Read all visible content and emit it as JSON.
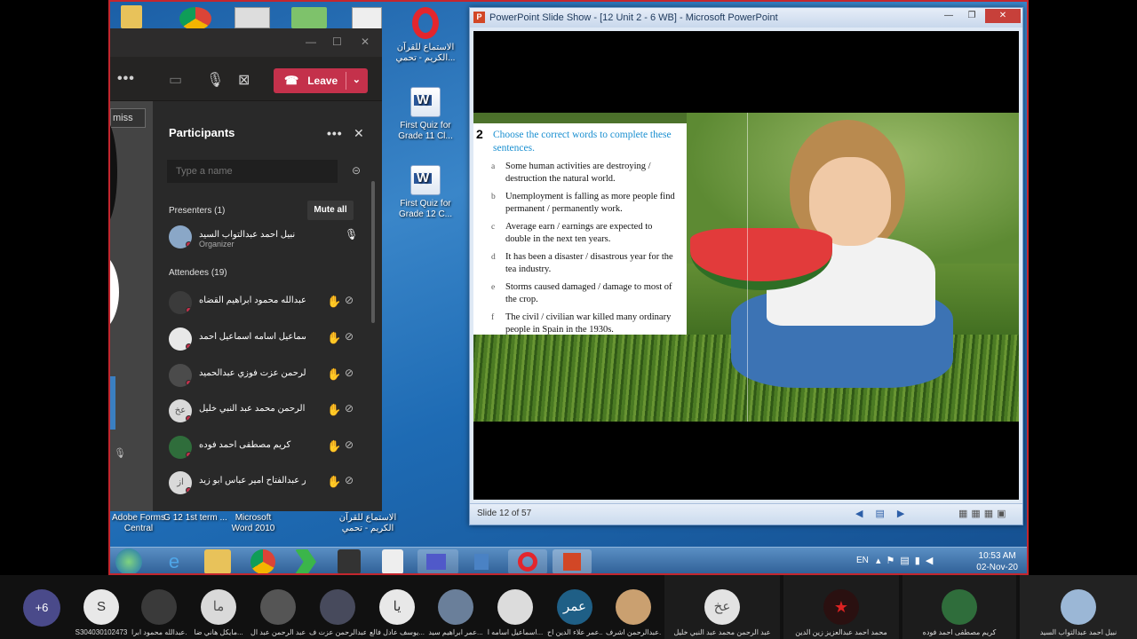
{
  "desktop_icons": [
    {
      "label": "الاستماع للقرآن الكريم - تحمي...",
      "name": "quran-shortcut"
    },
    {
      "label": "First Quiz for Grade 11 Cl...",
      "name": "word-doc-grade11"
    },
    {
      "label": "First Quiz for Grade 12 C...",
      "name": "word-doc-grade12"
    },
    {
      "label": "Adobe Forms Central",
      "name": "adobe-forms"
    },
    {
      "label": "G 12 1st term ...",
      "name": "g12-folder"
    },
    {
      "label": "Microsoft Word 2010",
      "name": "word-2010"
    },
    {
      "label": "الاستماع للقرآن الكريم - تحمي",
      "name": "quran-shortcut-2"
    }
  ],
  "teams": {
    "leave_label": "Leave",
    "dismiss_label": "miss",
    "participants_title": "Participants",
    "search_placeholder": "Type a name",
    "presenters_header": "Presenters (1)",
    "mute_all_label": "Mute all",
    "attendees_header": "Attendees (19)",
    "presenter": {
      "name": "نبيل احمد عبدالتواب السيد",
      "role": "Organizer",
      "initials": ""
    },
    "attendees": [
      {
        "name": "عبدالله محمود ابراهيم القضاه",
        "initials": "",
        "color": "#3b3b3b"
      },
      {
        "name": "اسماعيل اسامه اسماعيل احمد",
        "initials": "",
        "color": "#e8e8e8"
      },
      {
        "name": "عبدالرحمن عزت فوزي عبدالحميد",
        "initials": "",
        "color": "#4b4b4b"
      },
      {
        "name": "عبد الرحمن محمد عبد النبي خليل",
        "initials": "عخ",
        "color": "#d9d9d9"
      },
      {
        "name": "كريم مصطفى احمد فوده",
        "initials": "",
        "color": "#2f6d3b"
      },
      {
        "name": "امير عبدالفتاح امير عباس ابو زيد",
        "initials": "از",
        "color": "#d9d9d9"
      }
    ]
  },
  "ppt": {
    "window_title": "PowerPoint Slide Show - [12 Unit 2 - 6 WB] - Microsoft PowerPoint",
    "slide_status": "Slide 12 of 57",
    "exercise_number": "2",
    "exercise_heading": "Choose the correct words to complete these sentences.",
    "questions": [
      {
        "letter": "a",
        "text": "Some human activities are destroying / destruction the natural world."
      },
      {
        "letter": "b",
        "text": "Unemployment is falling as more people find permanent / permanently work."
      },
      {
        "letter": "c",
        "text": "Average earn / earnings are expected to double in the next ten years."
      },
      {
        "letter": "d",
        "text": "It has been a disaster / disastrous year for the tea industry."
      },
      {
        "letter": "e",
        "text": "Storms caused damaged / damage to most of the crop."
      },
      {
        "letter": "f",
        "text": "The civil / civilian war killed many ordinary people in Spain in the 1930s."
      }
    ]
  },
  "taskbar": {
    "lang": "EN",
    "time": "10:53 AM",
    "date": "02-Nov-20"
  },
  "strip": {
    "more_count": "+6",
    "tiles": [
      {
        "initials": "S",
        "name": "S304030102473",
        "color": "#e8e8e8",
        "text_color": "#333"
      },
      {
        "initials": "",
        "name": "عبدالله محمود ابرا...",
        "color": "#3a3a3a",
        "text_color": "#fff"
      },
      {
        "initials": "ما",
        "name": "مايكل هاني ضا...",
        "color": "#d9d9d9",
        "text_color": "#333"
      },
      {
        "initials": "",
        "name": "عبد الرحمن عبد ال...",
        "color": "#555555",
        "text_color": "#fff"
      },
      {
        "initials": "",
        "name": "عبدالرحمن عزت ف...",
        "color": "#474a5c",
        "text_color": "#fff"
      },
      {
        "initials": "يا",
        "name": "يوسف عادل فالع...",
        "color": "#e8e8e8",
        "text_color": "#333"
      },
      {
        "initials": "",
        "name": "عمر ابراهيم سيد...",
        "color": "#6a7f9a",
        "text_color": "#fff"
      },
      {
        "initials": "",
        "name": "اسماعيل اسامه ا...",
        "color": "#dcdcdc",
        "text_color": "#fff"
      },
      {
        "initials": "عمر",
        "name": "عمر علاء الدين اح...",
        "color": "#1f5f86",
        "text_color": "#fff"
      },
      {
        "initials": "",
        "name": "عبدالرحمن اشرف...",
        "color": "#caa070",
        "text_color": "#fff"
      },
      {
        "initials": "عخ",
        "name": "عبد الرحمن محمد عبد النبي خليل",
        "color": "#e3e3e3",
        "text_color": "#333"
      },
      {
        "initials": "",
        "name": "محمد احمد عبدالعزيز زين الدين",
        "color": "#2a1010",
        "text_color": "#fff"
      },
      {
        "initials": "",
        "name": "كريم مصطفى احمد فوده",
        "color": "#2f6d3b",
        "text_color": "#fff"
      },
      {
        "initials": "",
        "name": "نبيل احمد عبدالتواب السيد",
        "color": "#9bb7d6",
        "text_color": "#fff"
      }
    ]
  }
}
